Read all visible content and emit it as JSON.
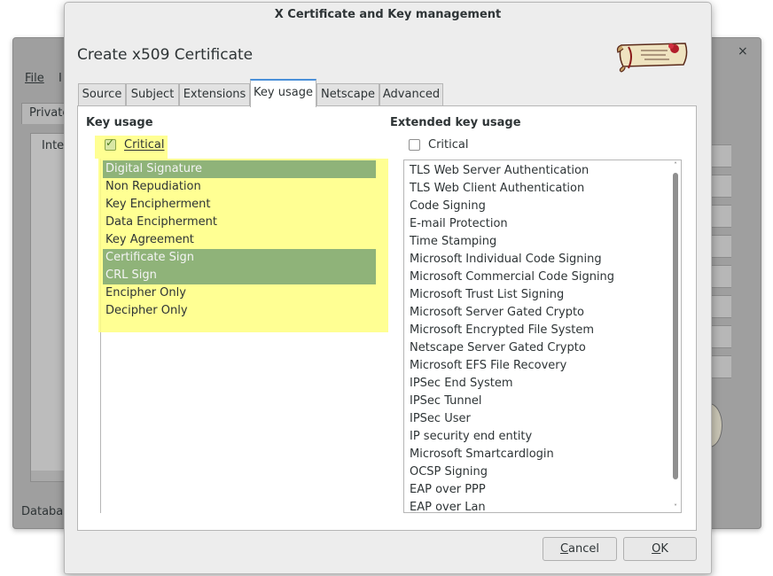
{
  "background_window": {
    "menu": [
      "File",
      "I"
    ],
    "tab": "Private",
    "list_header": "Inter",
    "status": "Databas",
    "close": "×"
  },
  "dialog": {
    "title": "X Certificate and Key management",
    "heading": "Create x509 Certificate",
    "tabs": [
      "Source",
      "Subject",
      "Extensions",
      "Key usage",
      "Netscape",
      "Advanced"
    ],
    "active_tab": "Key usage"
  },
  "key_usage": {
    "label": "Key usage",
    "critical_label": "Critical",
    "critical_checked": true,
    "items": [
      {
        "label": "Digital Signature",
        "selected": true
      },
      {
        "label": "Non Repudiation",
        "selected": false
      },
      {
        "label": "Key Encipherment",
        "selected": false
      },
      {
        "label": "Data Encipherment",
        "selected": false
      },
      {
        "label": "Key Agreement",
        "selected": false
      },
      {
        "label": "Certificate Sign",
        "selected": true
      },
      {
        "label": "CRL Sign",
        "selected": true
      },
      {
        "label": "Encipher Only",
        "selected": false
      },
      {
        "label": "Decipher Only",
        "selected": false
      }
    ]
  },
  "extended_key_usage": {
    "label": "Extended key usage",
    "critical_label": "Critical",
    "critical_checked": false,
    "items": [
      "TLS Web Server Authentication",
      "TLS Web Client Authentication",
      "Code Signing",
      "E-mail Protection",
      "Time Stamping",
      "Microsoft Individual Code Signing",
      "Microsoft Commercial Code Signing",
      "Microsoft Trust List Signing",
      "Microsoft Server Gated Crypto",
      "Microsoft Encrypted File System",
      "Netscape Server Gated Crypto",
      "Microsoft EFS File Recovery",
      "IPSec End System",
      "IPSec Tunnel",
      "IPSec User",
      "IP security end entity",
      "Microsoft Smartcardlogin",
      "OCSP Signing",
      "EAP over PPP",
      "EAP over Lan"
    ],
    "scrollbar": {
      "arrow_up": "˄",
      "arrow_down": "˅"
    }
  },
  "buttons": {
    "cancel": {
      "mnemonic": "C",
      "rest": "ancel"
    },
    "ok": {
      "mnemonic": "O",
      "rest": "K"
    }
  },
  "colors": {
    "selection": "#8fb379",
    "highlight": "#ffff80",
    "tab_accent": "#4a90d9"
  }
}
